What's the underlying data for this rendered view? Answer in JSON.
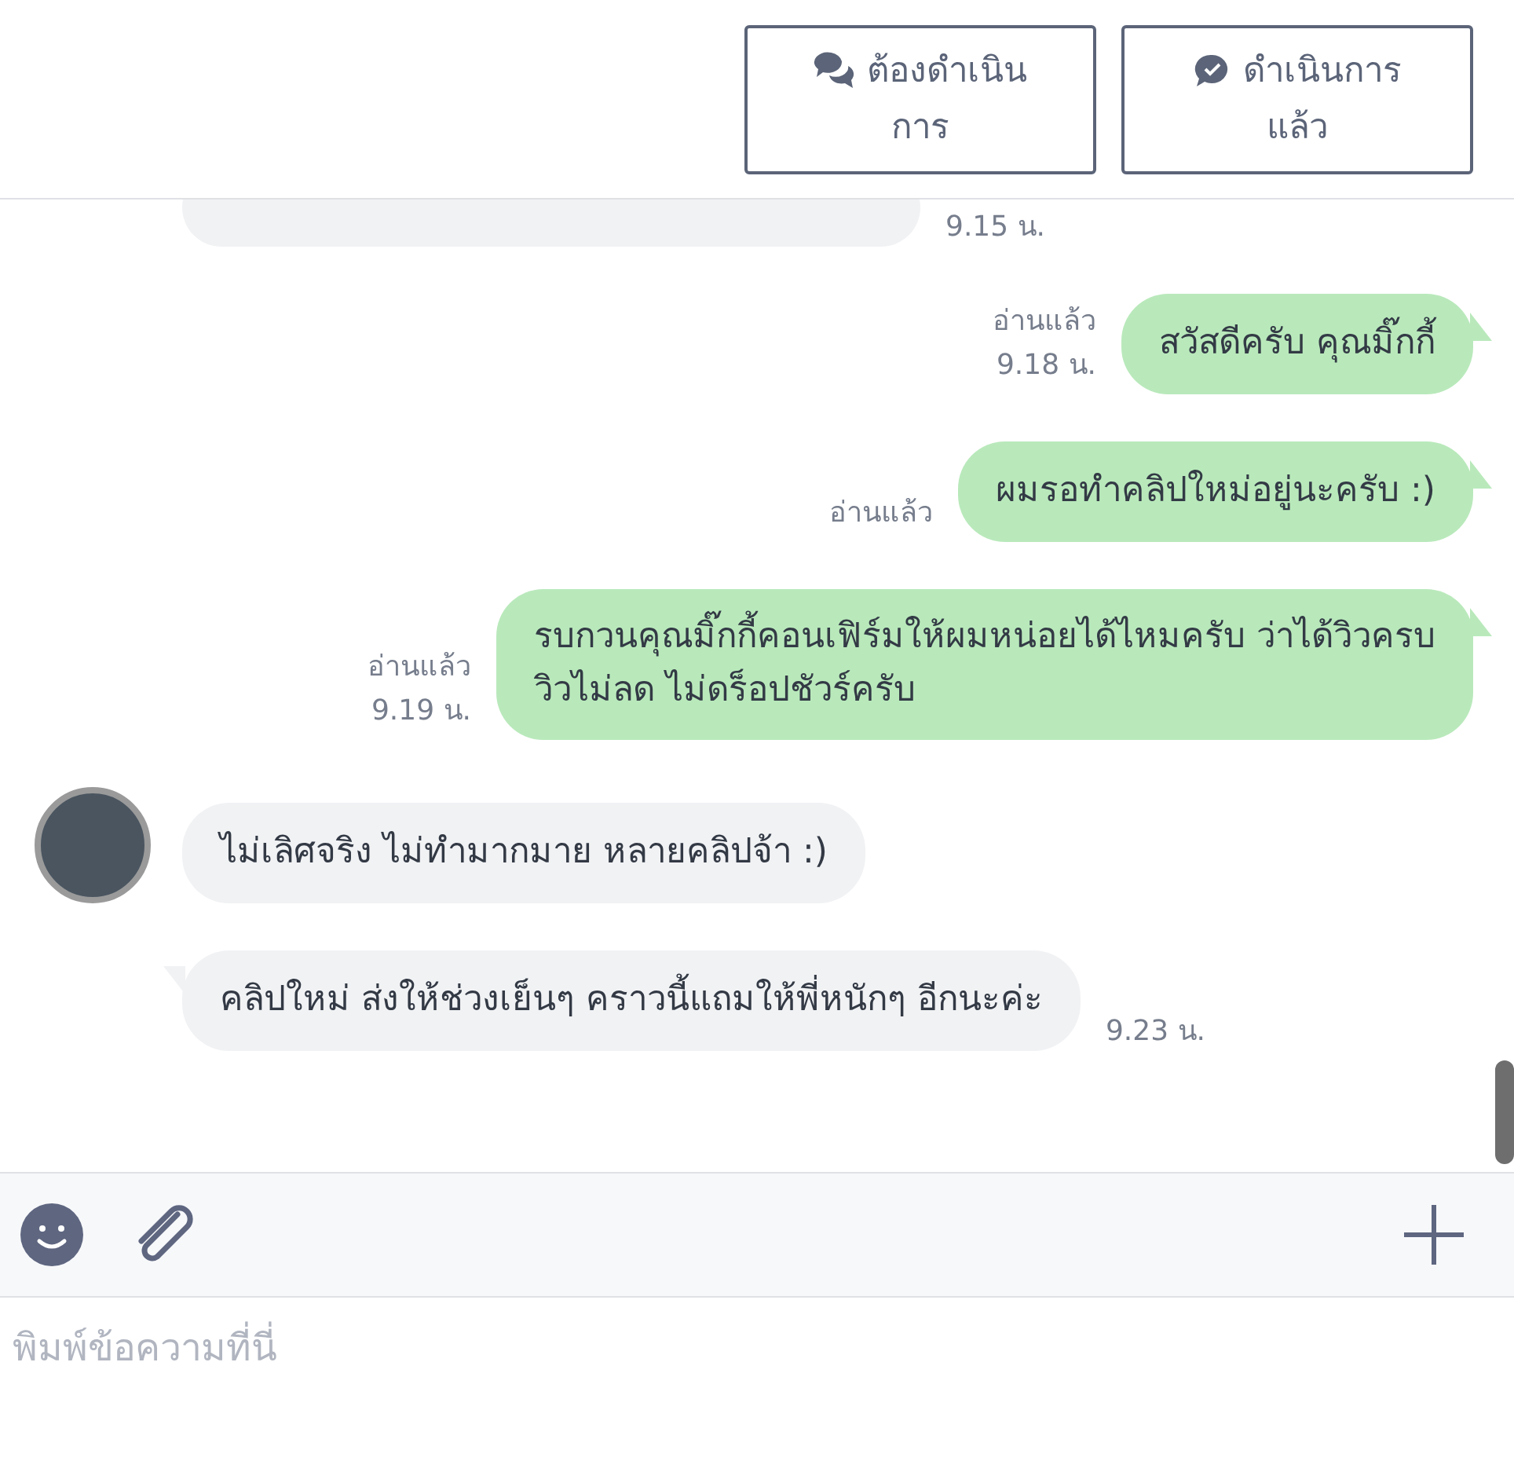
{
  "header": {
    "buttons": [
      {
        "label": "ต้องดำเนินการ"
      },
      {
        "label": "ดำเนินการแล้ว"
      }
    ]
  },
  "messages": [
    {
      "kind": "incoming",
      "avatar": false,
      "time": "9.15 น."
    },
    {
      "kind": "outgoing",
      "read": "อ่านแล้ว",
      "time": "9.18 น.",
      "text": "สวัสดีครับ คุณมิ๊กกี้"
    },
    {
      "kind": "outgoing",
      "read": "อ่านแล้ว",
      "text": "ผมรอทำคลิปใหม่อยู่นะครับ :)"
    },
    {
      "kind": "outgoing",
      "read": "อ่านแล้ว",
      "time": "9.19 น.",
      "lines": [
        "รบกวนคุณมิ๊กกี้คอนเฟิร์มให้ผมหน่อยได้ไหมครับ ว่าได้วิวครบ",
        "วิวไม่ลด ไม่ดร็อปชัวร์ครับ"
      ]
    },
    {
      "kind": "incoming",
      "avatar": true,
      "text": "ไม่เลิศจริง ไม่ทำมากมาย หลายคลิปจ้า :)"
    },
    {
      "kind": "incoming",
      "avatar": false,
      "time": "9.23 น.",
      "text": "คลิปใหม่ ส่งให้ช่วงเย็นๆ คราวนี้แถมให้พี่หนักๆ อีกนะค่ะ"
    }
  ],
  "composer": {
    "placeholder": "พิมพ์ข้อความที่นี่"
  }
}
